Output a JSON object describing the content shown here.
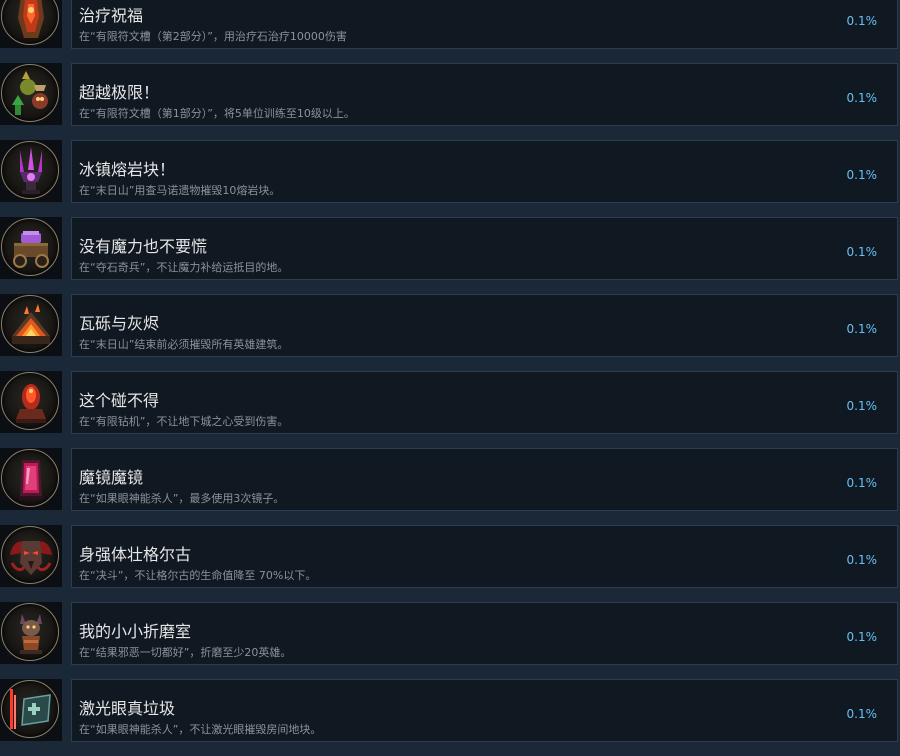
{
  "achievements": [
    {
      "title": "治疗祝福",
      "desc": "在“有限符文槽（第2部分）”，用治疗石治疗10000伤害",
      "percent": "0.1%",
      "icon": "healing-idol-icon"
    },
    {
      "title": "超越极限！",
      "desc": "在“有限符文槽（第1部分）”，将5单位训练至10级以上。",
      "percent": "0.1%",
      "icon": "level-up-minions-icon"
    },
    {
      "title": "冰镇熔岩块！",
      "desc": "在“末日山”用查马诺遗物摧毁10熔岩块。",
      "percent": "0.1%",
      "icon": "relic-crystal-icon"
    },
    {
      "title": "没有魔力也不要慌",
      "desc": "在“夺石奇兵”，不让魔力补给运抵目的地。",
      "percent": "0.1%",
      "icon": "mana-cart-icon"
    },
    {
      "title": "瓦砾与灰烬",
      "desc": "在“末日山”结束前必须摧毁所有英雄建筑。",
      "percent": "0.1%",
      "icon": "burning-building-icon"
    },
    {
      "title": "这个碰不得",
      "desc": "在“有限钻机”，不让地下城之心受到伤害。",
      "percent": "0.1%",
      "icon": "dungeon-heart-icon"
    },
    {
      "title": "魔镜魔镜",
      "desc": "在“如果眼神能杀人”，最多使用3次镜子。",
      "percent": "0.1%",
      "icon": "magic-mirror-icon"
    },
    {
      "title": "身强体壮格尔古",
      "desc": "在“决斗”，不让格尔古的生命值降至 70%以下。",
      "percent": "0.1%",
      "icon": "demon-helm-icon"
    },
    {
      "title": "我的小小折磨室",
      "desc": "在“结果邪恶一切都好”，折磨至少20英雄。",
      "percent": "0.1%",
      "icon": "torture-imp-icon"
    },
    {
      "title": "激光眼真垃圾",
      "desc": "在“如果眼神能杀人”，不让激光眼摧毁房间地块。",
      "percent": "0.1%",
      "icon": "laser-floor-tile-icon"
    }
  ]
}
